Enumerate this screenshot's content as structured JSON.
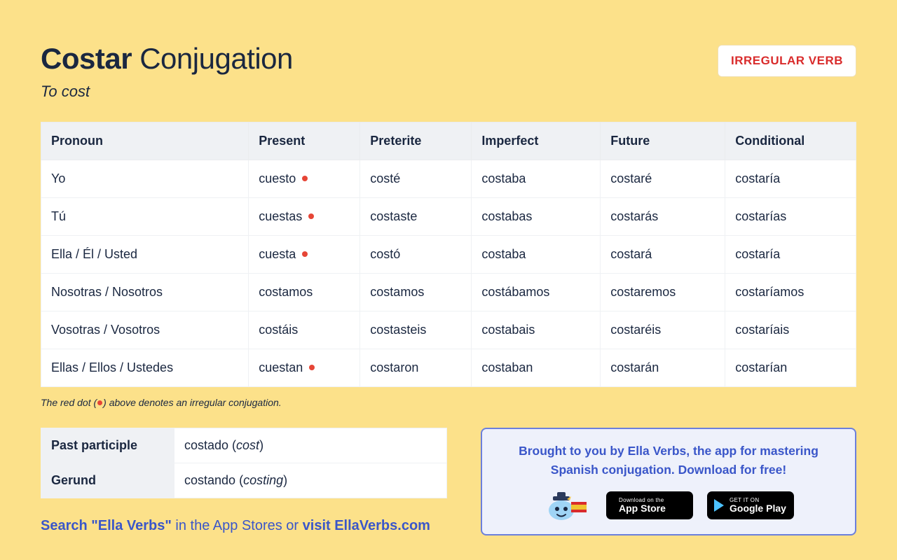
{
  "header": {
    "verb": "Costar",
    "word_conjugation": "Conjugation",
    "translation": "To cost",
    "badge": "IRREGULAR VERB"
  },
  "columns": [
    "Pronoun",
    "Present",
    "Preterite",
    "Imperfect",
    "Future",
    "Conditional"
  ],
  "rows": [
    {
      "pronoun": "Yo",
      "present": "cuesto",
      "present_irr": true,
      "preterite": "costé",
      "imperfect": "costaba",
      "future": "costaré",
      "conditional": "costaría"
    },
    {
      "pronoun": "Tú",
      "present": "cuestas",
      "present_irr": true,
      "preterite": "costaste",
      "imperfect": "costabas",
      "future": "costarás",
      "conditional": "costarías"
    },
    {
      "pronoun": "Ella / Él / Usted",
      "present": "cuesta",
      "present_irr": true,
      "preterite": "costó",
      "imperfect": "costaba",
      "future": "costará",
      "conditional": "costaría"
    },
    {
      "pronoun": "Nosotras / Nosotros",
      "present": "costamos",
      "present_irr": false,
      "preterite": "costamos",
      "imperfect": "costábamos",
      "future": "costaremos",
      "conditional": "costaríamos"
    },
    {
      "pronoun": "Vosotras / Vosotros",
      "present": "costáis",
      "present_irr": false,
      "preterite": "costasteis",
      "imperfect": "costabais",
      "future": "costaréis",
      "conditional": "costaríais"
    },
    {
      "pronoun": "Ellas / Ellos / Ustedes",
      "present": "cuestan",
      "present_irr": true,
      "preterite": "costaron",
      "imperfect": "costaban",
      "future": "costarán",
      "conditional": "costarían"
    }
  ],
  "footnote": {
    "before": "The red dot (",
    "after": ") above denotes an irregular conjugation."
  },
  "forms": {
    "past_participle_label": "Past participle",
    "past_participle_value": "costado",
    "past_participle_gloss": "cost",
    "gerund_label": "Gerund",
    "gerund_value": "costando",
    "gerund_gloss": "costing"
  },
  "search_line": {
    "a": "Search \"Ella Verbs\"",
    "b": " in the App Stores or ",
    "c": "visit EllaVerbs.com"
  },
  "promo": {
    "text": "Brought to you by Ella Verbs, the app for mastering Spanish conjugation. Download for free!",
    "appstore_small": "Download on the",
    "appstore_big": "App Store",
    "play_small": "GET IT ON",
    "play_big": "Google Play"
  }
}
